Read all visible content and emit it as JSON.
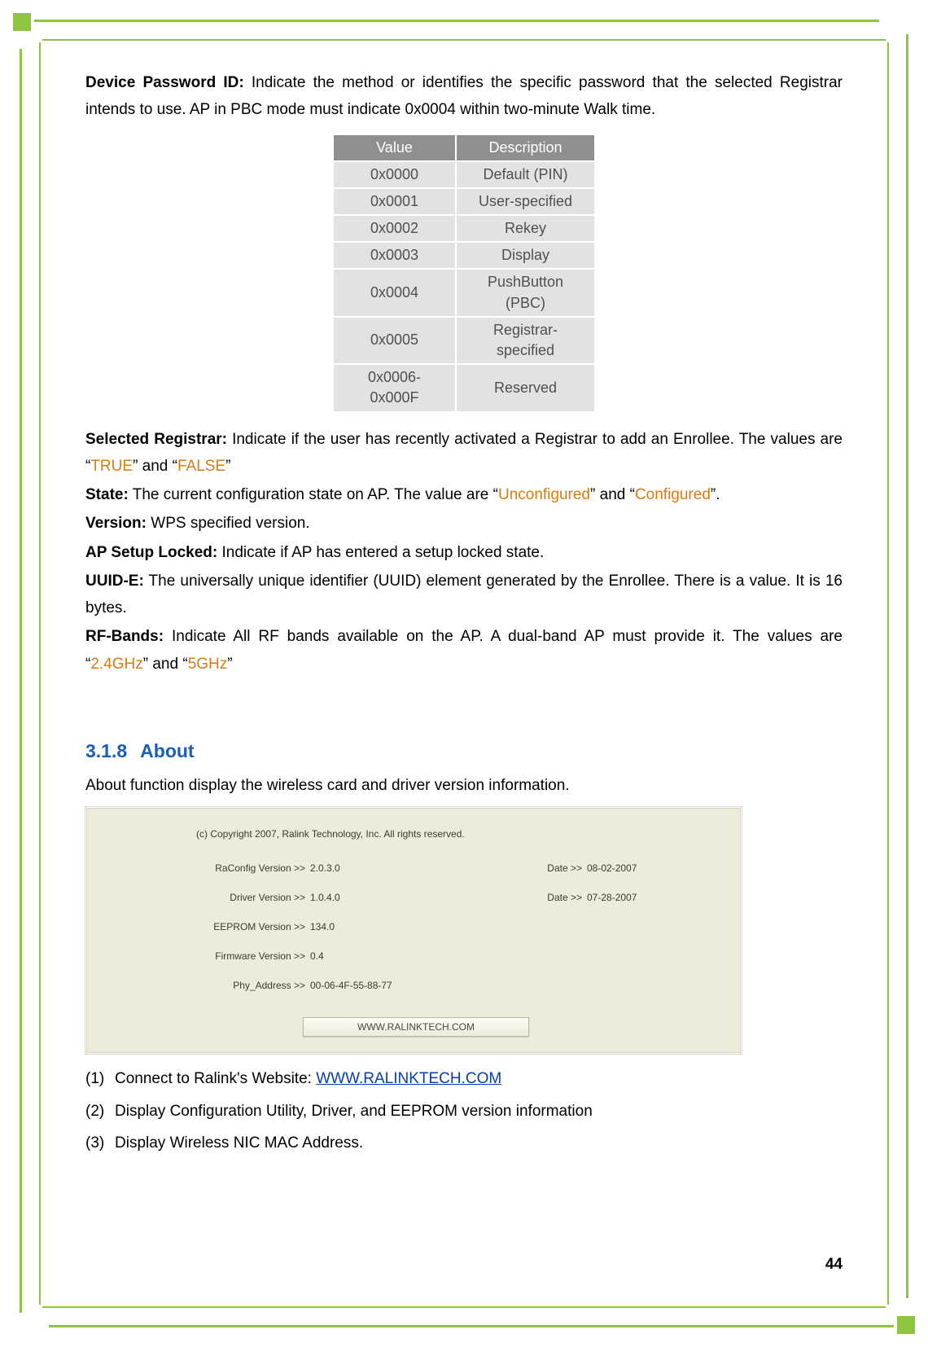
{
  "page_number": "44",
  "intro": {
    "device_password_id_label": "Device Password ID:",
    "device_password_id_text": " Indicate the method or identifies the specific password that the selected Registrar intends to use. AP in PBC mode must indicate 0x0004 within two-minute Walk time."
  },
  "value_table": {
    "headers": [
      "Value",
      "Description"
    ],
    "rows": [
      [
        "0x0000",
        "Default (PIN)"
      ],
      [
        "0x0001",
        "User-specified"
      ],
      [
        "0x0002",
        "Rekey"
      ],
      [
        "0x0003",
        "Display"
      ],
      [
        "0x0004",
        "PushButton (PBC)"
      ],
      [
        "0x0005",
        "Registrar-specified"
      ],
      [
        "0x0006-0x000F",
        "Reserved"
      ]
    ]
  },
  "defs": {
    "selected_registrar_label": "Selected Registrar:",
    "selected_registrar_text_a": " Indicate if the user has recently activated a Registrar to add an Enrollee. The values are “",
    "selected_registrar_true": "TRUE",
    "selected_registrar_text_b": "” and “",
    "selected_registrar_false": "FALSE",
    "selected_registrar_text_c": "”",
    "state_label": "State:",
    "state_text_a": " The current configuration state on AP. The value are “",
    "state_unconfigured": "Unconfigured",
    "state_text_b": "” and “",
    "state_configured": "Configured",
    "state_text_c": "”.",
    "version_label": "Version:",
    "version_text": " WPS specified version.",
    "apsetup_label": "AP Setup Locked:",
    "apsetup_text": " Indicate if AP has entered a setup locked state.",
    "uuid_label": "UUID-E:",
    "uuid_text": " The universally unique identifier (UUID) element generated by the Enrollee. There is a value. It is 16 bytes.",
    "rf_label": "RF-Bands:",
    "rf_text_a": " Indicate All RF bands available on the AP. A dual-band AP must provide it. The values are “",
    "rf_24": "2.4GHz",
    "rf_text_b": "” and “",
    "rf_5": "5GHz",
    "rf_text_c": "”"
  },
  "section": {
    "number": "3.1.8",
    "title": "About",
    "caption": "About function display the wireless card and driver version information."
  },
  "about_panel": {
    "copyright": "(c) Copyright 2007, Ralink Technology, Inc. All rights reserved.",
    "rows": [
      {
        "label": "RaConfig Version >>",
        "value": "2.0.3.0",
        "date_label": "Date >>",
        "date_value": "08-02-2007"
      },
      {
        "label": "Driver Version >>",
        "value": "1.0.4.0",
        "date_label": "Date >>",
        "date_value": "07-28-2007"
      },
      {
        "label": "EEPROM Version >>",
        "value": "134.0",
        "date_label": "",
        "date_value": ""
      },
      {
        "label": "Firmware Version >>",
        "value": "0.4",
        "date_label": "",
        "date_value": ""
      },
      {
        "label": "Phy_Address >>",
        "value": "00-06-4F-55-88-77",
        "date_label": "",
        "date_value": ""
      }
    ],
    "button": "WWW.RALINKTECH.COM"
  },
  "list": {
    "items": [
      {
        "num": "(1)",
        "text_a": "Connect to Ralink's Website: ",
        "link": "WWW.RALINKTECH.COM",
        "text_b": ""
      },
      {
        "num": "(2)",
        "text_a": "Display Configuration Utility, Driver, and EEPROM version information",
        "link": "",
        "text_b": ""
      },
      {
        "num": "(3)",
        "text_a": "Display Wireless NIC MAC Address.",
        "link": "",
        "text_b": ""
      }
    ]
  }
}
